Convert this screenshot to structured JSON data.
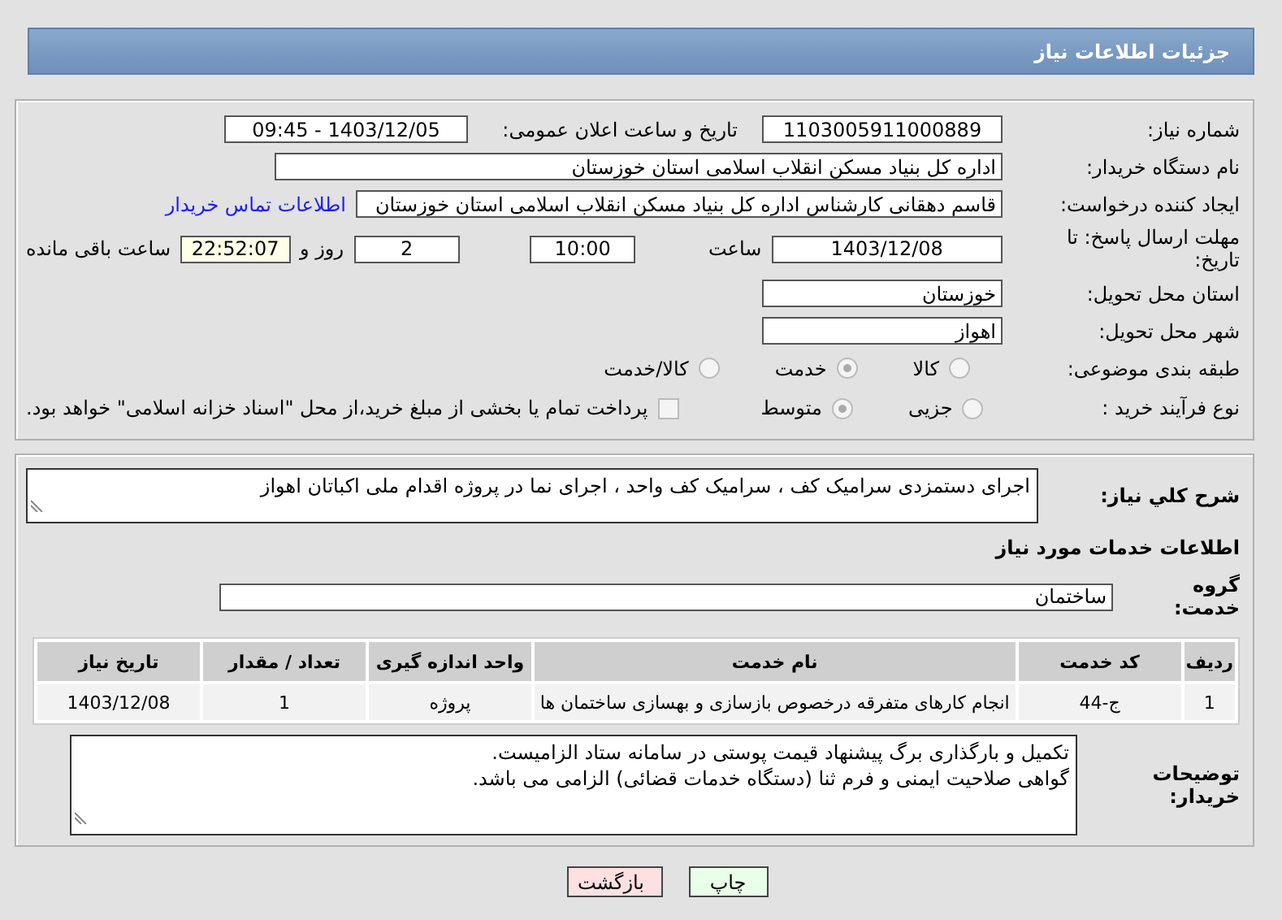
{
  "header": {
    "title": "جزئیات اطلاعات نیاز"
  },
  "need_number": {
    "label": "شماره نیاز:",
    "value": "1103005911000889"
  },
  "announce": {
    "label": "تاریخ و ساعت اعلان عمومی:",
    "value": "1403/12/05 - 09:45"
  },
  "buyer_org": {
    "label": "نام دستگاه خریدار:",
    "value": "اداره کل بنیاد مسکن انقلاب اسلامی استان خوزستان"
  },
  "requester": {
    "label": "ایجاد کننده درخواست:",
    "value": "قاسم دهقانی کارشناس اداره کل بنیاد مسکن انقلاب اسلامی استان خوزستان",
    "link": "اطلاعات تماس خریدار"
  },
  "deadline": {
    "label": "مهلت ارسال پاسخ: تا تاریخ:",
    "date": "1403/12/08",
    "time_label": "ساعت",
    "time": "10:00",
    "days": "2",
    "days_label": "روز و",
    "remaining": "22:52:07",
    "remaining_label": "ساعت باقی مانده"
  },
  "province": {
    "label": "استان محل تحویل:",
    "value": "خوزستان"
  },
  "city": {
    "label": "شهر محل تحویل:",
    "value": "اهواز"
  },
  "category": {
    "label": "طبقه بندی موضوعی:",
    "options": [
      {
        "label": "کالا",
        "selected": false
      },
      {
        "label": "خدمت",
        "selected": true
      },
      {
        "label": "کالا/خدمت",
        "selected": false
      }
    ]
  },
  "process": {
    "label": "نوع فرآیند خرید :",
    "options": [
      {
        "label": "جزیی",
        "selected": false
      },
      {
        "label": "متوسط",
        "selected": true
      }
    ],
    "payment": {
      "checked": false,
      "text": "پرداخت تمام یا بخشی از مبلغ خرید،از محل \"اسناد خزانه اسلامی\" خواهد بود."
    }
  },
  "description": {
    "label": "شرح کلي نياز:",
    "value": "اجرای دستمزدی سرامیک کف ، سرامیک کف واحد ، اجرای نما در پروژه اقدام ملی اکباتان اهواز"
  },
  "services_heading": "اطلاعات خدمات مورد نیاز",
  "service_group": {
    "label": "گروه خدمت:",
    "value": "ساختمان"
  },
  "table": {
    "columns": [
      "ردیف",
      "کد خدمت",
      "نام خدمت",
      "واحد اندازه گیری",
      "تعداد / مقدار",
      "تاریخ نیاز"
    ],
    "rows": [
      [
        "1",
        "ج-44",
        "انجام کارهای متفرقه درخصوص بازسازی و بهسازی ساختمان ها",
        "پروژه",
        "1",
        "1403/12/08"
      ]
    ]
  },
  "buyer_notes": {
    "label": "توضیحات خریدار:",
    "lines": [
      "تکمیل و بارگذاری برگ پیشنهاد قیمت پوستی در سامانه ستاد الزامیست.",
      "گواهی صلاحیت ایمنی و فرم ثنا (دستگاه خدمات قضائی) الزامی می باشد."
    ]
  },
  "buttons": [
    {
      "label": "چاپ",
      "kind": "print"
    },
    {
      "label": "بازگشت",
      "kind": "back"
    }
  ]
}
